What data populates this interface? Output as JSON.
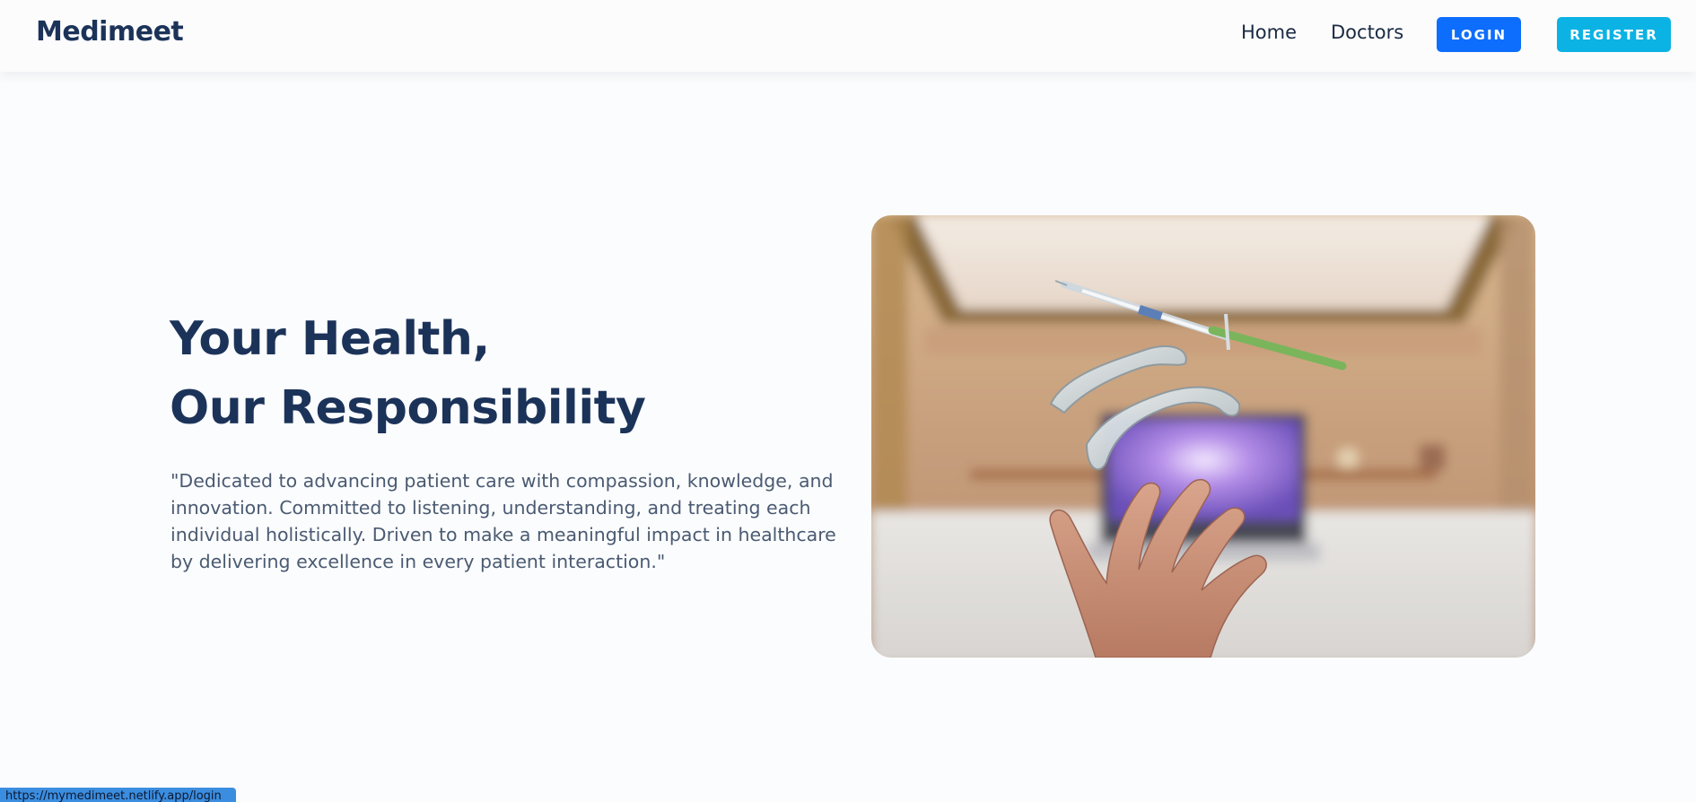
{
  "navbar": {
    "brand": "Medimeet",
    "links": [
      "Home",
      "Doctors"
    ],
    "login_label": "LOGIN",
    "register_label": "REGISTER"
  },
  "hero": {
    "title_line1": "Your Health,",
    "title_line2": "Our Responsibility",
    "description": "\"Dedicated to advancing patient care with compassion, knowledge, and innovation. Committed to listening, understanding, and treating each individual holistically. Driven to make a meaningful impact in healthcare by delivering excellence in every patient interaction.\""
  },
  "status_bar": {
    "url": "https://mymedimeet.netlify.app/login"
  },
  "colors": {
    "brand": "#1c3359",
    "login": "#0d6efd",
    "register": "#0bb2e4"
  }
}
